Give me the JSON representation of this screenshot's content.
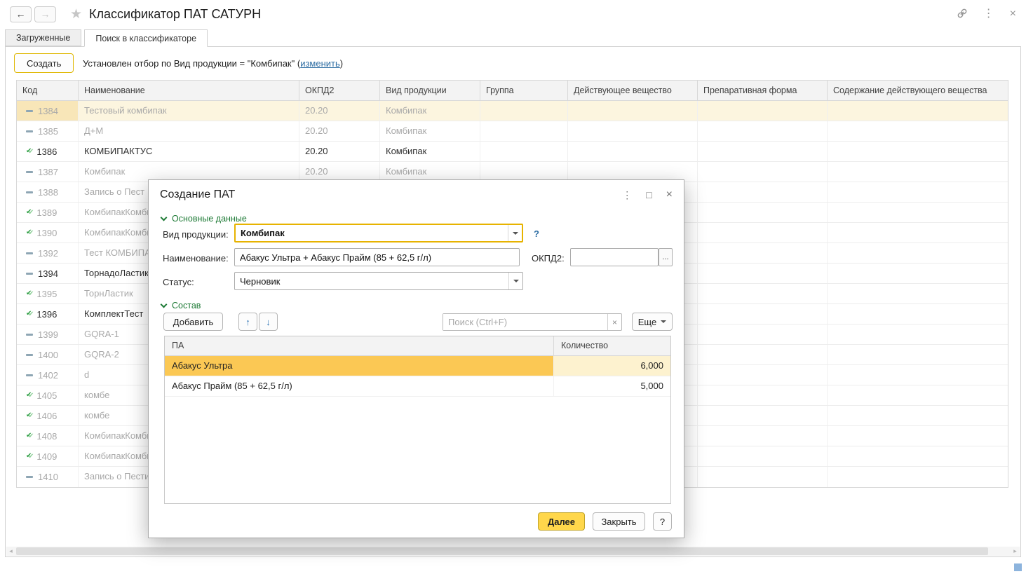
{
  "window": {
    "title": "Классификатор ПАТ САТУРН",
    "nav": {
      "back": "←",
      "forward": "→"
    },
    "icons": {
      "star": "★",
      "link": "link",
      "menu": "⋮",
      "close": "×"
    }
  },
  "tabs": [
    {
      "label": "Загруженные",
      "active": false
    },
    {
      "label": "Поиск в классификаторе",
      "active": true
    }
  ],
  "commandbar": {
    "create_button": "Создать",
    "filter_prefix": "Установлен отбор по Вид продукции = \"Комбипак\" (",
    "filter_link": "изменить",
    "filter_suffix": ")"
  },
  "table": {
    "columns": [
      "Код",
      "Наименование",
      "ОКПД2",
      "Вид продукции",
      "Группа",
      "Действующее вещество",
      "Препаративная форма",
      "Содержание действующего вещества"
    ],
    "rows": [
      {
        "icon": "dash",
        "code": "1384",
        "name": "Тестовый комбипак",
        "okpd2": "20.20",
        "product_type": "Комбипак",
        "muted": true,
        "selected": true
      },
      {
        "icon": "dash",
        "code": "1385",
        "name": "Д+М",
        "okpd2": "20.20",
        "product_type": "Комбипак",
        "muted": true,
        "selected": false
      },
      {
        "icon": "check",
        "code": "1386",
        "name": "КОМБИПАКТУС",
        "okpd2": "20.20",
        "product_type": "Комбипак",
        "muted": false,
        "selected": false
      },
      {
        "icon": "dash",
        "code": "1387",
        "name": "Комбипак",
        "okpd2": "20.20",
        "product_type": "Комбипак",
        "muted": true,
        "selected": false
      },
      {
        "icon": "dash",
        "code": "1388",
        "name": "Запись о Пест",
        "okpd2": "",
        "product_type": "",
        "muted": true,
        "selected": false
      },
      {
        "icon": "check",
        "code": "1389",
        "name": "КомбипакКомби",
        "okpd2": "",
        "product_type": "",
        "muted": true,
        "selected": false
      },
      {
        "icon": "check",
        "code": "1390",
        "name": "КомбипакКомби",
        "okpd2": "",
        "product_type": "",
        "muted": true,
        "selected": false
      },
      {
        "icon": "dash",
        "code": "1392",
        "name": "Тест КОМБИПА",
        "okpd2": "",
        "product_type": "",
        "muted": true,
        "selected": false
      },
      {
        "icon": "dash",
        "code": "1394",
        "name": "ТорнадоЛастик",
        "okpd2": "",
        "product_type": "",
        "muted": false,
        "selected": false
      },
      {
        "icon": "check",
        "code": "1395",
        "name": "ТорнЛастик",
        "okpd2": "",
        "product_type": "",
        "muted": true,
        "selected": false
      },
      {
        "icon": "check",
        "code": "1396",
        "name": "КомплектТест",
        "okpd2": "",
        "product_type": "",
        "muted": false,
        "selected": false
      },
      {
        "icon": "dash",
        "code": "1399",
        "name": "GQRA-1",
        "okpd2": "",
        "product_type": "",
        "muted": true,
        "selected": false
      },
      {
        "icon": "dash",
        "code": "1400",
        "name": "GQRA-2",
        "okpd2": "",
        "product_type": "",
        "muted": true,
        "selected": false
      },
      {
        "icon": "dash",
        "code": "1402",
        "name": "d",
        "okpd2": "",
        "product_type": "",
        "muted": true,
        "selected": false
      },
      {
        "icon": "check",
        "code": "1405",
        "name": "комбе",
        "okpd2": "",
        "product_type": "",
        "muted": true,
        "selected": false
      },
      {
        "icon": "check",
        "code": "1406",
        "name": "комбе",
        "okpd2": "",
        "product_type": "",
        "muted": true,
        "selected": false
      },
      {
        "icon": "check",
        "code": "1408",
        "name": "КомбипакКомби",
        "okpd2": "",
        "product_type": "",
        "muted": true,
        "selected": false
      },
      {
        "icon": "check",
        "code": "1409",
        "name": "КомбипакКомби",
        "okpd2": "",
        "product_type": "",
        "muted": true,
        "selected": false
      },
      {
        "icon": "dash",
        "code": "1410",
        "name": "Запись о Пести",
        "okpd2": "",
        "product_type": "",
        "muted": true,
        "selected": false
      }
    ]
  },
  "scrollbar": {
    "left_arrow": "◂",
    "right_arrow": "▸"
  },
  "dialog": {
    "title": "Создание ПАТ",
    "window_icons": {
      "menu": "⋮",
      "maximize": "□",
      "close": "×"
    },
    "sections": {
      "main": "Основные данные",
      "composition": "Состав"
    },
    "fields": {
      "product_type": {
        "label": "Вид продукции:",
        "value": "Комбипак",
        "help": "?"
      },
      "name": {
        "label": "Наименование:",
        "value": "Абакус Ультра + Абакус Прайм (85 + 62,5 г/л)"
      },
      "okpd2": {
        "label": "ОКПД2:",
        "value": "",
        "more": "..."
      },
      "status": {
        "label": "Статус:",
        "value": "Черновик"
      }
    },
    "composition_toolbar": {
      "add": "Добавить",
      "up_arrow": "↑",
      "down_arrow": "↓",
      "search_placeholder": "Поиск (Ctrl+F)",
      "clear": "×",
      "more": "Еще"
    },
    "composition_table": {
      "columns": [
        "ПА",
        "Количество"
      ],
      "rows": [
        {
          "name": "Абакус Ультра",
          "quantity": "6,000",
          "selected": true
        },
        {
          "name": "Абакус Прайм (85 + 62,5 г/л)",
          "quantity": "5,000",
          "selected": false
        }
      ]
    },
    "footer": {
      "next": "Далее",
      "close": "Закрыть",
      "help": "?"
    }
  },
  "colors": {
    "accent_yellow": "#ffd74b",
    "selected_row": "#fcf5df",
    "selected_cell": "#fbc854",
    "section_green": "#1d7a35",
    "link_blue": "#2d6da3"
  }
}
